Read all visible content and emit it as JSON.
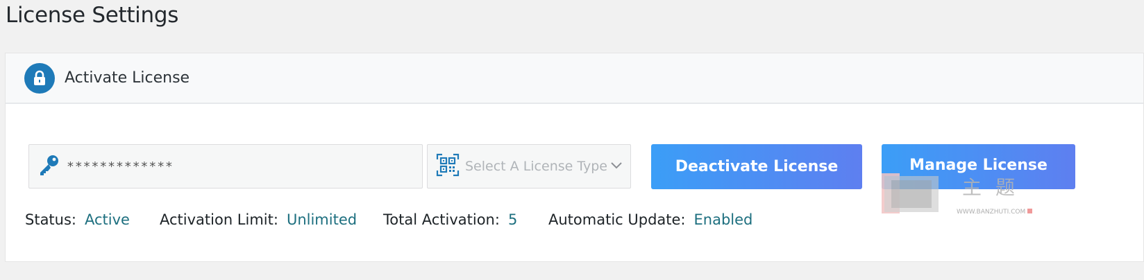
{
  "page": {
    "title": "License Settings"
  },
  "card": {
    "title": "Activate License",
    "icon": "lock-icon"
  },
  "form": {
    "license_key_value": "*************",
    "license_key_icon": "key-icon",
    "license_type_placeholder": "Select A License Type",
    "license_type_icon": "qr-code-icon",
    "deactivate_label": "Deactivate License",
    "manage_label": "Manage License"
  },
  "status": {
    "status_label": "Status:",
    "status_value": "Active",
    "limit_label": "Activation Limit:",
    "limit_value": "Unlimited",
    "total_label": "Total Activation:",
    "total_value": "5",
    "update_label": "Automatic Update:",
    "update_value": "Enabled"
  },
  "watermark": {
    "text": "WWW.BANZHUTI.COM"
  },
  "colors": {
    "accent": "#1e7ab8",
    "button_start": "#3b9ef7",
    "button_end": "#5e7ff0",
    "status_value": "#1d6f7f"
  }
}
